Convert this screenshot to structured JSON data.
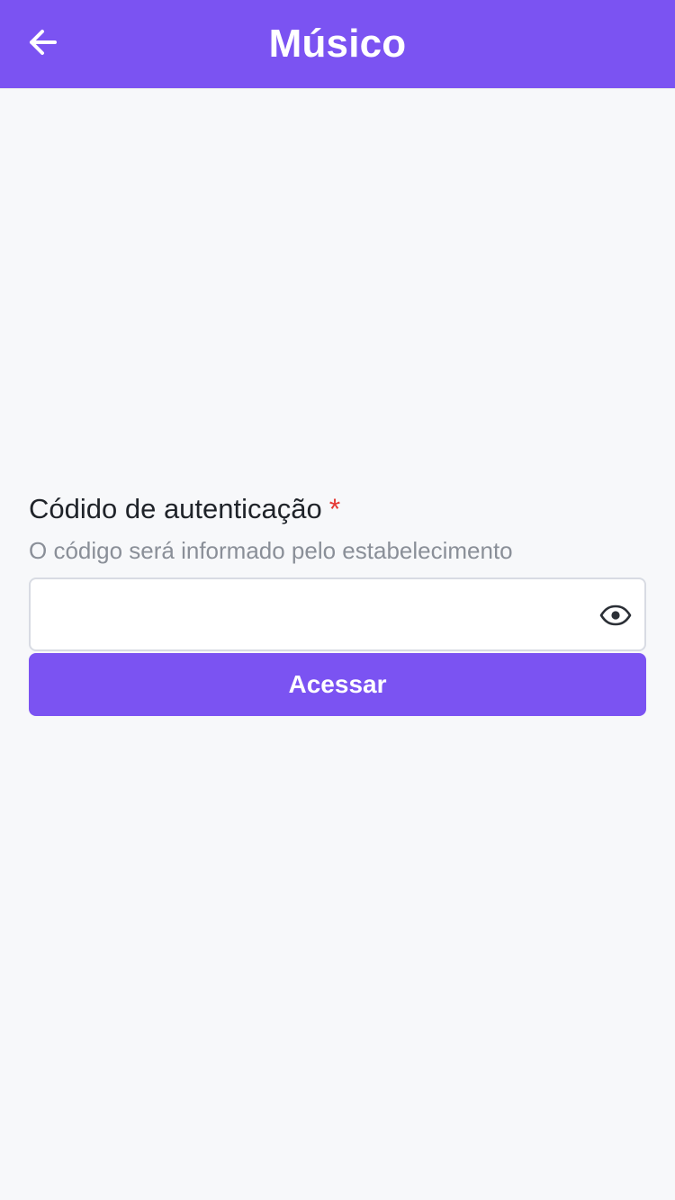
{
  "app_bar": {
    "title": "Músico",
    "back_icon": "arrow-left-icon"
  },
  "form": {
    "label": "Códido de autenticação",
    "required_marker": "*",
    "help_text": "O código será informado pelo estabelecimento",
    "input_value": "",
    "visibility_icon": "eye-icon",
    "submit_label": "Acessar"
  },
  "colors": {
    "primary": "#7b53f2",
    "background": "#f7f8fa",
    "required": "#e53935",
    "help_text": "#8a8f98"
  }
}
